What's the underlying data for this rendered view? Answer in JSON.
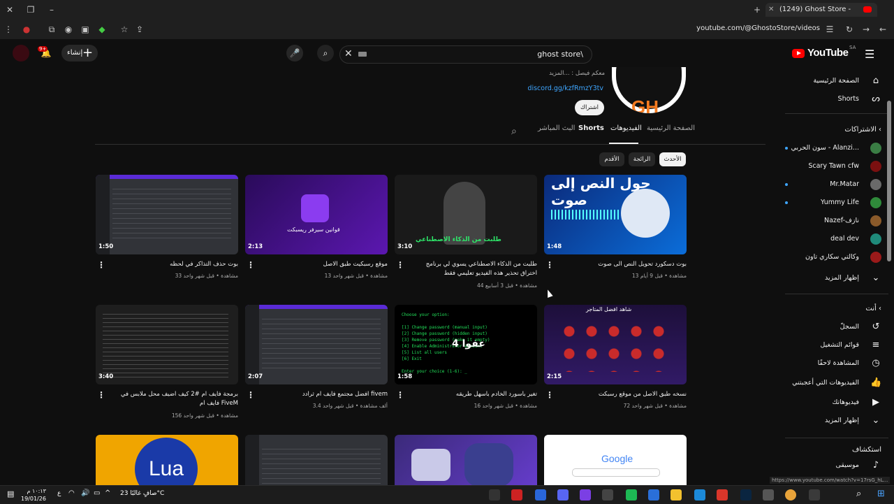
{
  "browser": {
    "tab_title": "(1249) Ghost Store - YouTube",
    "url": "youtube.com/@GhostoStore/videos",
    "status_url": "https://www.youtube.com/watch?v=17rsG_hL..."
  },
  "header": {
    "logo_text": "YouTube",
    "logo_region": "SA",
    "search_value": "ghost store\\",
    "create_label": "إنشاء",
    "notif_count": "9+"
  },
  "channel": {
    "description": "معكم فيصل : ...المزيد",
    "link": "discord.gg/kzfRmzY3tv",
    "subscribe_label": "اشتراك"
  },
  "tabs": [
    {
      "label": "الصفحة الرئيسية"
    },
    {
      "label": "الفيديوهات"
    },
    {
      "label": "Shorts"
    },
    {
      "label": "البث المباشر"
    }
  ],
  "chips": [
    {
      "label": "الأحدث"
    },
    {
      "label": "الرائجة"
    },
    {
      "label": "الأقدم"
    }
  ],
  "videos": [
    {
      "title": "بوت دسكورد تحويل النص الى صوت",
      "meta": "13 مشاهدة • قبل 9 أيام",
      "duration": "1:48",
      "thumb_text": "حول النص إلى صوت"
    },
    {
      "title": "طلبت من الذكاء الاصطناعي يسوي لي برنامج اختراق تحذير هذه الفيديو تعليمي فقط",
      "meta": "44 مشاهدة • قبل 3 أسابيع",
      "duration": "3:10",
      "thumb_text": "طلبت من الذكاء الاصطناعي"
    },
    {
      "title": "موقع رسبكيت طبق الاصل",
      "meta": "13 مشاهدة • قبل شهر واحد",
      "duration": "2:13",
      "thumb_text": "قوانين سيرفر ريسبكت"
    },
    {
      "title": "بوت حذف التذاكر في لحظه",
      "meta": "33 مشاهدة • قبل شهر واحد",
      "duration": "1:50",
      "thumb_text": ""
    },
    {
      "title": "نسخه طبق الاصل من موقع رسبكت",
      "meta": "72 مشاهدة • قبل شهر واحد",
      "duration": "2:15",
      "thumb_text": "شاهد افضل المتاجر"
    },
    {
      "title": "تغير باسورد الخادم باسهل طريقه",
      "meta": "16 مشاهدة • قبل شهر واحد",
      "duration": "1:58",
      "thumb_text": "عفوا 4"
    },
    {
      "title": "افضل مجتمع فايف ام ثرادد fivem",
      "meta": "3.4 ألف مشاهدة • قبل شهر واحد",
      "duration": "2:07",
      "thumb_text": ""
    },
    {
      "title": "برمجة فايف ام #2 كيف اضيف محل ملابس في فايف ام FiveM",
      "meta": "156 مشاهدة • قبل شهر واحد",
      "duration": "3:40",
      "thumb_text": ""
    },
    {
      "title": "",
      "meta": "",
      "duration": "",
      "thumb_text": "Google"
    },
    {
      "title": "",
      "meta": "",
      "duration": "",
      "thumb_text": ""
    },
    {
      "title": "",
      "meta": "",
      "duration": "",
      "thumb_text": ""
    },
    {
      "title": "",
      "meta": "",
      "duration": "",
      "thumb_text": "Lua"
    }
  ],
  "sidebar": {
    "home": "الصفحة الرئيسية",
    "shorts": "Shorts",
    "subs_header": "الاشتراكات",
    "subscriptions": [
      {
        "name": "سون الحربي - Alanzi...",
        "color": "#3a7d44",
        "live": true
      },
      {
        "name": "Scary Tawn cfw",
        "color": "#7a1010",
        "live": false
      },
      {
        "name": "Mr.Matar",
        "color": "#6a6a6a",
        "live": true
      },
      {
        "name": "Yummy Life",
        "color": "#2f8a3a",
        "live": true
      },
      {
        "name": "Nazef-نازف",
        "color": "#8a5a2a",
        "live": false
      },
      {
        "name": "deal dev",
        "color": "#1f8a7a",
        "live": false
      },
      {
        "name": "وكالتي سكاري تاون",
        "color": "#9a1a1a",
        "live": false
      }
    ],
    "show_more": "إظهار المزيد",
    "you_header": "أنت",
    "you_items": [
      {
        "label": "السجلّ",
        "icon": "history-icon"
      },
      {
        "label": "قوائم التشغيل",
        "icon": "playlist-icon"
      },
      {
        "label": "المشاهدة لاحقًا",
        "icon": "clock-icon"
      },
      {
        "label": "الفيديوهات التي أعجبتني",
        "icon": "thumb-up-icon"
      },
      {
        "label": "فيديوهاتك",
        "icon": "your-videos-icon"
      }
    ],
    "show_more_2": "إظهار المزيد",
    "explore_header": "استكشاف",
    "music": "موسيقى"
  },
  "taskbar": {
    "time": "١٠:١٣ م",
    "date": "19/01/26",
    "weather": "صافٍ غالبًا  23°C",
    "lang": "ع"
  }
}
